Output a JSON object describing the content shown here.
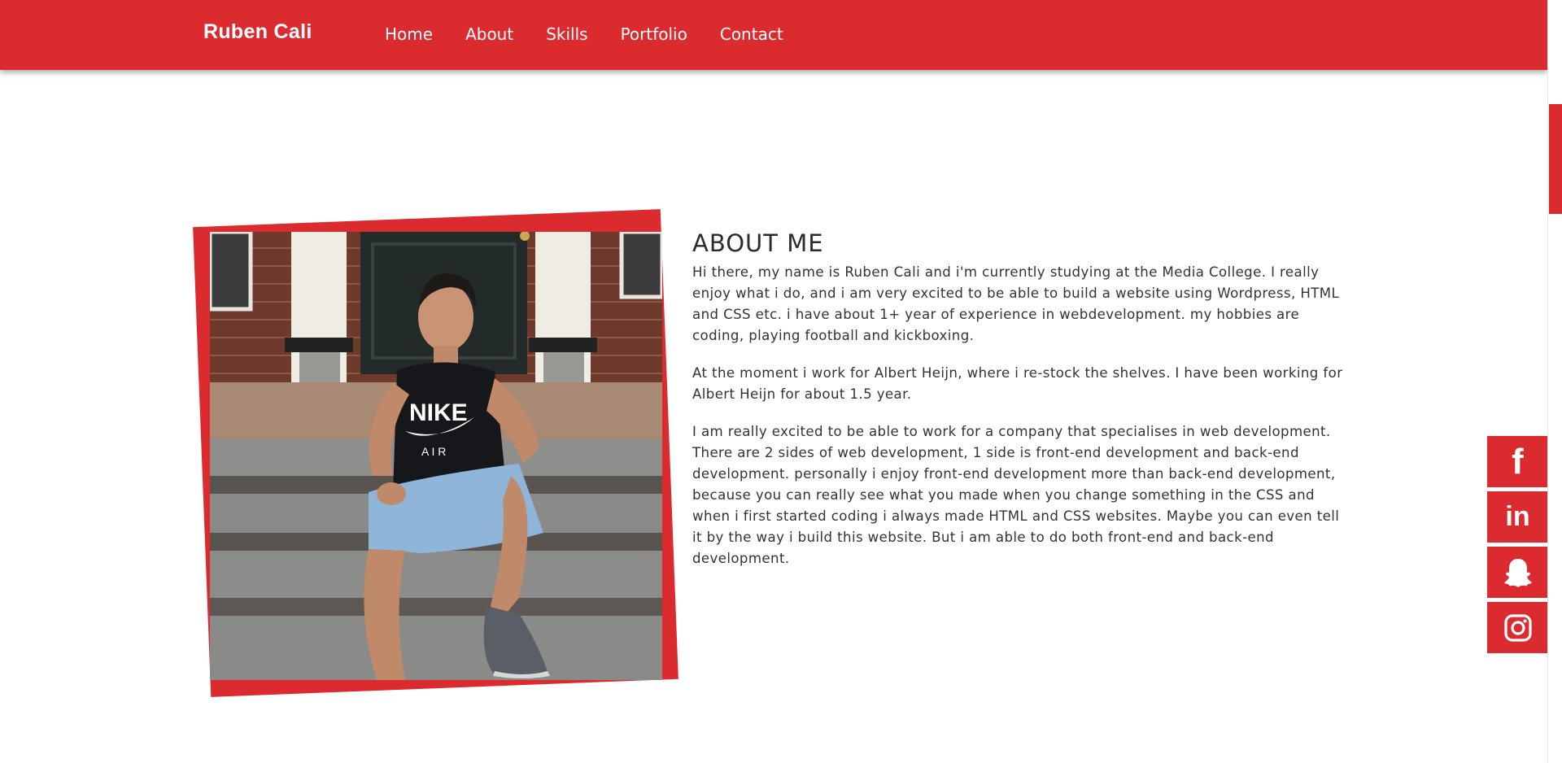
{
  "colors": {
    "accent": "#db2b2f",
    "text": "#333333",
    "background": "#ffffff"
  },
  "header": {
    "brand": "Ruben Cali",
    "nav": [
      {
        "label": "Home"
      },
      {
        "label": "About"
      },
      {
        "label": "Skills"
      },
      {
        "label": "Portfolio"
      },
      {
        "label": "Contact"
      }
    ]
  },
  "about": {
    "title": "ABOUT ME",
    "paragraphs": [
      "Hi there, my name is Ruben Cali and i'm currently studying at the Media College. I really enjoy what i do, and i am very excited to be able to build a website using Wordpress, HTML and CSS etc. i have about 1+ year of experience in webdevelopment. my hobbies are coding, playing football and kickboxing.",
      "At the moment i work for Albert Heijn, where i re-stock the shelves. I have been working for Albert Heijn for about 1.5 year.",
      "I am really excited to be able to work for a company that specialises in web development. There are 2 sides of web development, 1 side is front-end development and back-end development. personally i enjoy front-end development more than back-end development, because you can really see what you made when you change something in the CSS and when i first started coding i always made HTML and CSS websites. Maybe you can even tell it by the way i build this website. But i am able to do both front-end and back-end development."
    ],
    "photo": {
      "shirt_text": "NIKE",
      "shirt_subtext": "A I R"
    }
  },
  "social": [
    {
      "icon": "facebook-icon",
      "glyph": "f"
    },
    {
      "icon": "linkedin-icon",
      "glyph": "in"
    },
    {
      "icon": "snapchat-icon",
      "glyph": ""
    },
    {
      "icon": "instagram-icon",
      "glyph": ""
    }
  ]
}
